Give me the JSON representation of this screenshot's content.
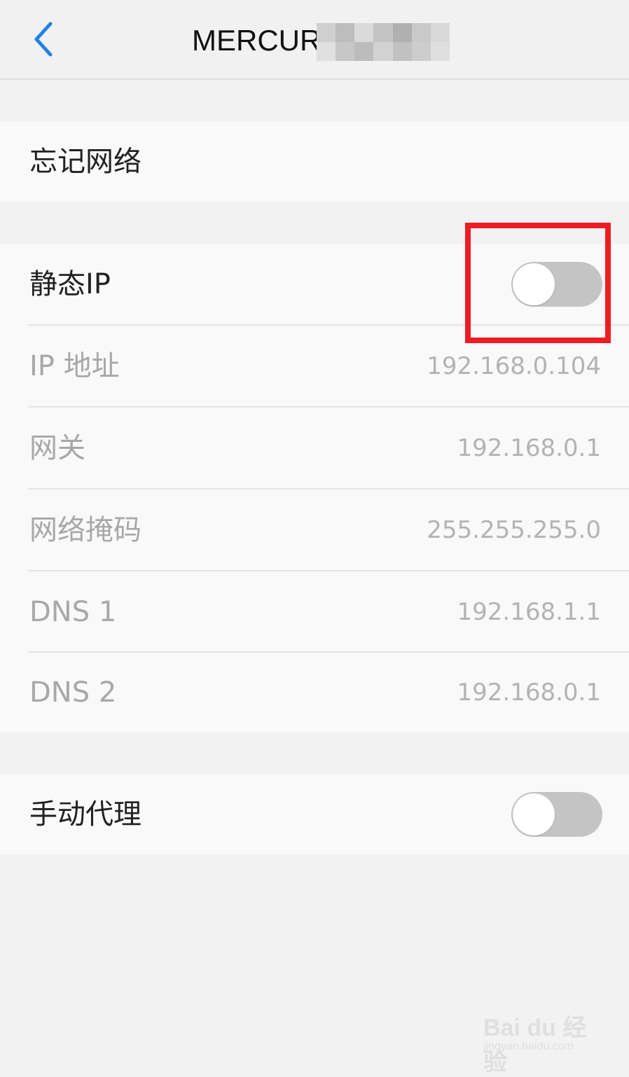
{
  "header": {
    "title": "MERCUR",
    "back_icon": "chevron-left-icon",
    "accent_color": "#1e82e6"
  },
  "forget_network": {
    "label": "忘记网络"
  },
  "static_ip": {
    "label": "静态IP",
    "toggle_on": false
  },
  "ip_fields": [
    {
      "label": "IP 地址",
      "value": "192.168.0.104"
    },
    {
      "label": "网关",
      "value": "192.168.0.1"
    },
    {
      "label": "网络掩码",
      "value": "255.255.255.0"
    },
    {
      "label": "DNS 1",
      "value": "192.168.1.1"
    },
    {
      "label": "DNS 2",
      "value": "192.168.0.1"
    }
  ],
  "manual_proxy": {
    "label": "手动代理",
    "toggle_on": false
  },
  "highlight_color": "#ee1c25",
  "watermark": {
    "main": "Bai du 经验",
    "sub": "jingyan.baidu.com"
  }
}
